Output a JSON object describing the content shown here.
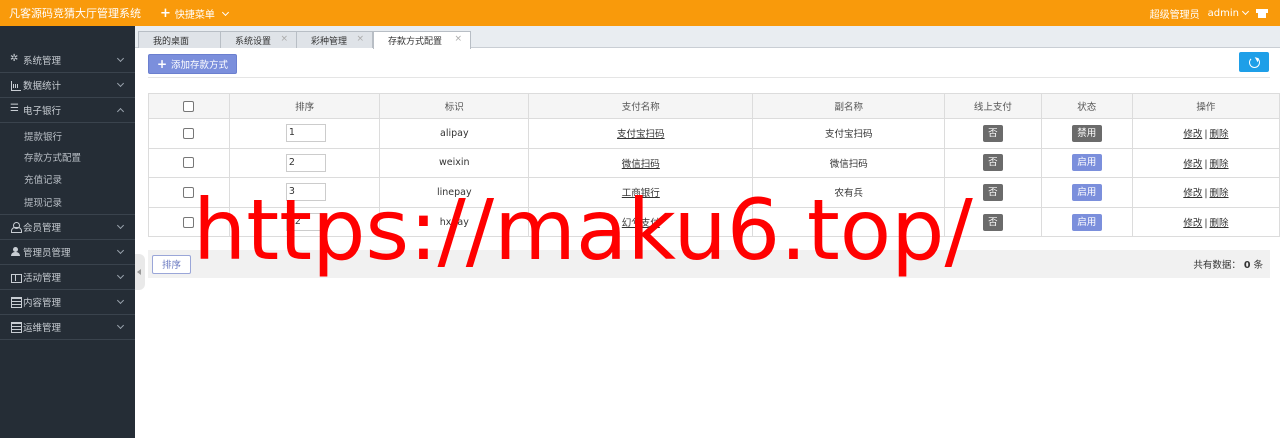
{
  "header": {
    "app_title": "凡客源码竞猜大厅管理系统",
    "quick_menu": "快捷菜单",
    "role": "超级管理员",
    "user": "admin"
  },
  "sidebar": {
    "items": [
      {
        "label": "系统管理",
        "icon": "gear-icon",
        "expanded": false
      },
      {
        "label": "数据统计",
        "icon": "bar-chart-icon",
        "expanded": false
      },
      {
        "label": "电子银行",
        "icon": "list-icon",
        "expanded": true,
        "children": [
          "提款银行",
          "存款方式配置",
          "充值记录",
          "提现记录"
        ]
      },
      {
        "label": "会员管理",
        "icon": "user-outline-icon",
        "expanded": false
      },
      {
        "label": "管理员管理",
        "icon": "user-icon",
        "expanded": false
      },
      {
        "label": "活动管理",
        "icon": "gift-icon",
        "expanded": false
      },
      {
        "label": "内容管理",
        "icon": "document-icon",
        "expanded": false
      },
      {
        "label": "运维管理",
        "icon": "document-icon",
        "expanded": false
      }
    ]
  },
  "tabs": [
    {
      "label": "我的桌面",
      "closable": false,
      "active": false
    },
    {
      "label": "系统设置",
      "closable": true,
      "active": false
    },
    {
      "label": "彩种管理",
      "closable": true,
      "active": false
    },
    {
      "label": "存款方式配置",
      "closable": true,
      "active": true
    }
  ],
  "toolbar": {
    "add_label": "添加存款方式"
  },
  "table": {
    "columns": [
      "排序",
      "标识",
      "支付名称",
      "副名称",
      "线上支付",
      "状态",
      "操作"
    ],
    "rows": [
      {
        "sort": "1",
        "key": "alipay",
        "name": "支付宝扫码",
        "subname": "支付宝扫码",
        "online": "否",
        "status": "禁用",
        "edit": "修改",
        "delete": "删除"
      },
      {
        "sort": "2",
        "key": "weixin",
        "name": "微信扫码",
        "subname": "微信扫码",
        "online": "否",
        "status": "启用",
        "edit": "修改",
        "delete": "删除"
      },
      {
        "sort": "3",
        "key": "linepay",
        "name": "工商银行",
        "subname": "农有兵",
        "online": "否",
        "status": "启用",
        "edit": "修改",
        "delete": "删除"
      },
      {
        "sort": "32",
        "key": "hxpay",
        "name": "幻兮支付",
        "subname": "",
        "online": "否",
        "status": "启用",
        "edit": "修改",
        "delete": "删除"
      }
    ]
  },
  "footer": {
    "sort_label": "排序",
    "total_prefix": "共有数据：",
    "total_count": "0",
    "total_suffix": "条"
  },
  "watermark": "https://maku6.top/",
  "colors": {
    "header_bg": "#f99a0b",
    "sidebar_bg": "#252d36",
    "primary_btn": "#7b8fdc",
    "refresh_btn": "#1e9fe8",
    "status_disabled": "#6b6b6b",
    "status_enabled": "#7b8fdc",
    "watermark": "#ff0000"
  }
}
